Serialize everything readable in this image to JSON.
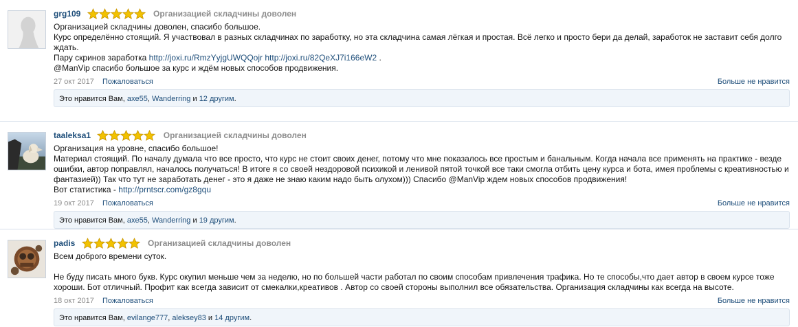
{
  "reviews": [
    {
      "username": "grg109",
      "verdict": "Организацией складчины доволен",
      "lines": [
        "Организацией складчины доволен, спасибо большое.",
        "Курс определённо стоящий. Я участвовал в разных складчинах по заработку, но эта складчина самая лёгкая и простая. Всё легко и просто бери да делай, заработок не заставит себя долго ждать."
      ],
      "screens_prefix": "Пару скринов заработка",
      "link1": "http://joxi.ru/RmzYyjgUWQQojr",
      "link2": "http://joxi.ru/82QeXJ7i166eW2",
      "screens_suffix": " .",
      "closing": "@ManVip спасибо большое за курс и ждём новых способов продвижения.",
      "date": "27 окт 2017",
      "report": "Пожаловаться",
      "unlike": "Больше не нравится",
      "likes_prefix": "Это нравится Вам, ",
      "like_user1": "axe55",
      "like_sep": ", ",
      "like_user2": "Wanderring",
      "like_and": " и ",
      "like_others": "12 другим",
      "like_end": "."
    },
    {
      "username": "taaleksa1",
      "verdict": "Организацией складчины доволен",
      "lines": [
        "Организация на уровне, спасибо большое!",
        "Материал стоящий. По началу думала что все просто, что курс не стоит своих денег, потому что мне показалось все простым и банальным. Когда начала все применять на практике - везде ошибки, автор поправлял, началось получаться! В итоге я со своей нездоровой психикой и ленивой пятой точкой все таки смогла отбить цену курса и бота, имея проблемы с креативностью и фантазией)) Так что тут не заработать денег - это я даже не знаю каким надо быть олухом))) Спасибо @ManVip ждем новых способов продвижения!"
      ],
      "stats_prefix": "Вот статистика - ",
      "stats_link": "http://prntscr.com/gz8gqu",
      "date": "19 окт 2017",
      "report": "Пожаловаться",
      "unlike": "Больше не нравится",
      "likes_prefix": "Это нравится Вам, ",
      "like_user1": "axe55",
      "like_sep": ", ",
      "like_user2": "Wanderring",
      "like_and": " и ",
      "like_others": "19 другим",
      "like_end": "."
    },
    {
      "username": "padis",
      "verdict": "Организацией складчины доволен",
      "lines": [
        "Всем доброго времени суток.",
        "Не буду писать много букв. Курс окупил меньше чем за неделю, но по большей части работал по своим способам привлечения трафика. Но те способы,что дает автор в своем курсе тоже хороши. Бот отличный. Профит как всегда зависит от смекалки,креативов . Автор со своей стороны выполнил все обязательства. Организация складчины как всегда на высоте."
      ],
      "date": "18 окт 2017",
      "report": "Пожаловаться",
      "unlike": "Больше не нравится",
      "likes_prefix": "Это нравится Вам, ",
      "like_user1": "evilange777",
      "like_sep": ", ",
      "like_user2": "aleksey83",
      "like_and": " и ",
      "like_others": "14 другим",
      "like_end": "."
    }
  ],
  "rating": {
    "stars": 5,
    "star_color": "#f2c200",
    "star_outline": "#c99600"
  },
  "colors": {
    "link": "#1e4e7a",
    "muted": "#8c8c8c",
    "likes_bg": "#f0f5fa",
    "border": "#d7dfea"
  }
}
